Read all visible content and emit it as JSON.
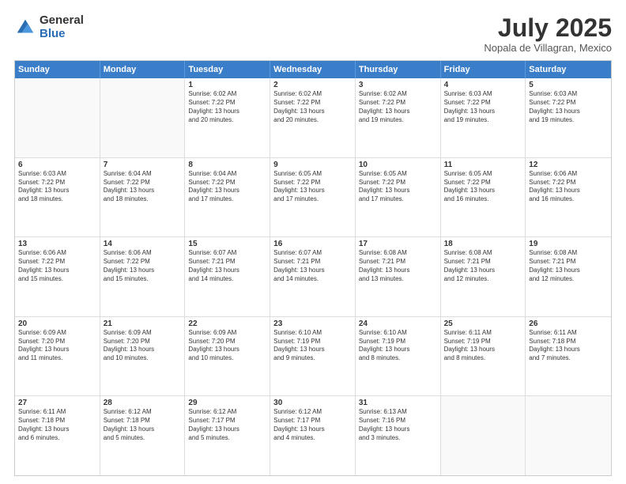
{
  "logo": {
    "general": "General",
    "blue": "Blue"
  },
  "header": {
    "month": "July 2025",
    "location": "Nopala de Villagran, Mexico"
  },
  "days": [
    "Sunday",
    "Monday",
    "Tuesday",
    "Wednesday",
    "Thursday",
    "Friday",
    "Saturday"
  ],
  "weeks": [
    [
      {
        "day": "",
        "content": ""
      },
      {
        "day": "",
        "content": ""
      },
      {
        "day": "1",
        "content": "Sunrise: 6:02 AM\nSunset: 7:22 PM\nDaylight: 13 hours\nand 20 minutes."
      },
      {
        "day": "2",
        "content": "Sunrise: 6:02 AM\nSunset: 7:22 PM\nDaylight: 13 hours\nand 20 minutes."
      },
      {
        "day": "3",
        "content": "Sunrise: 6:02 AM\nSunset: 7:22 PM\nDaylight: 13 hours\nand 19 minutes."
      },
      {
        "day": "4",
        "content": "Sunrise: 6:03 AM\nSunset: 7:22 PM\nDaylight: 13 hours\nand 19 minutes."
      },
      {
        "day": "5",
        "content": "Sunrise: 6:03 AM\nSunset: 7:22 PM\nDaylight: 13 hours\nand 19 minutes."
      }
    ],
    [
      {
        "day": "6",
        "content": "Sunrise: 6:03 AM\nSunset: 7:22 PM\nDaylight: 13 hours\nand 18 minutes."
      },
      {
        "day": "7",
        "content": "Sunrise: 6:04 AM\nSunset: 7:22 PM\nDaylight: 13 hours\nand 18 minutes."
      },
      {
        "day": "8",
        "content": "Sunrise: 6:04 AM\nSunset: 7:22 PM\nDaylight: 13 hours\nand 17 minutes."
      },
      {
        "day": "9",
        "content": "Sunrise: 6:05 AM\nSunset: 7:22 PM\nDaylight: 13 hours\nand 17 minutes."
      },
      {
        "day": "10",
        "content": "Sunrise: 6:05 AM\nSunset: 7:22 PM\nDaylight: 13 hours\nand 17 minutes."
      },
      {
        "day": "11",
        "content": "Sunrise: 6:05 AM\nSunset: 7:22 PM\nDaylight: 13 hours\nand 16 minutes."
      },
      {
        "day": "12",
        "content": "Sunrise: 6:06 AM\nSunset: 7:22 PM\nDaylight: 13 hours\nand 16 minutes."
      }
    ],
    [
      {
        "day": "13",
        "content": "Sunrise: 6:06 AM\nSunset: 7:22 PM\nDaylight: 13 hours\nand 15 minutes."
      },
      {
        "day": "14",
        "content": "Sunrise: 6:06 AM\nSunset: 7:22 PM\nDaylight: 13 hours\nand 15 minutes."
      },
      {
        "day": "15",
        "content": "Sunrise: 6:07 AM\nSunset: 7:21 PM\nDaylight: 13 hours\nand 14 minutes."
      },
      {
        "day": "16",
        "content": "Sunrise: 6:07 AM\nSunset: 7:21 PM\nDaylight: 13 hours\nand 14 minutes."
      },
      {
        "day": "17",
        "content": "Sunrise: 6:08 AM\nSunset: 7:21 PM\nDaylight: 13 hours\nand 13 minutes."
      },
      {
        "day": "18",
        "content": "Sunrise: 6:08 AM\nSunset: 7:21 PM\nDaylight: 13 hours\nand 12 minutes."
      },
      {
        "day": "19",
        "content": "Sunrise: 6:08 AM\nSunset: 7:21 PM\nDaylight: 13 hours\nand 12 minutes."
      }
    ],
    [
      {
        "day": "20",
        "content": "Sunrise: 6:09 AM\nSunset: 7:20 PM\nDaylight: 13 hours\nand 11 minutes."
      },
      {
        "day": "21",
        "content": "Sunrise: 6:09 AM\nSunset: 7:20 PM\nDaylight: 13 hours\nand 10 minutes."
      },
      {
        "day": "22",
        "content": "Sunrise: 6:09 AM\nSunset: 7:20 PM\nDaylight: 13 hours\nand 10 minutes."
      },
      {
        "day": "23",
        "content": "Sunrise: 6:10 AM\nSunset: 7:19 PM\nDaylight: 13 hours\nand 9 minutes."
      },
      {
        "day": "24",
        "content": "Sunrise: 6:10 AM\nSunset: 7:19 PM\nDaylight: 13 hours\nand 8 minutes."
      },
      {
        "day": "25",
        "content": "Sunrise: 6:11 AM\nSunset: 7:19 PM\nDaylight: 13 hours\nand 8 minutes."
      },
      {
        "day": "26",
        "content": "Sunrise: 6:11 AM\nSunset: 7:18 PM\nDaylight: 13 hours\nand 7 minutes."
      }
    ],
    [
      {
        "day": "27",
        "content": "Sunrise: 6:11 AM\nSunset: 7:18 PM\nDaylight: 13 hours\nand 6 minutes."
      },
      {
        "day": "28",
        "content": "Sunrise: 6:12 AM\nSunset: 7:18 PM\nDaylight: 13 hours\nand 5 minutes."
      },
      {
        "day": "29",
        "content": "Sunrise: 6:12 AM\nSunset: 7:17 PM\nDaylight: 13 hours\nand 5 minutes."
      },
      {
        "day": "30",
        "content": "Sunrise: 6:12 AM\nSunset: 7:17 PM\nDaylight: 13 hours\nand 4 minutes."
      },
      {
        "day": "31",
        "content": "Sunrise: 6:13 AM\nSunset: 7:16 PM\nDaylight: 13 hours\nand 3 minutes."
      },
      {
        "day": "",
        "content": ""
      },
      {
        "day": "",
        "content": ""
      }
    ]
  ]
}
